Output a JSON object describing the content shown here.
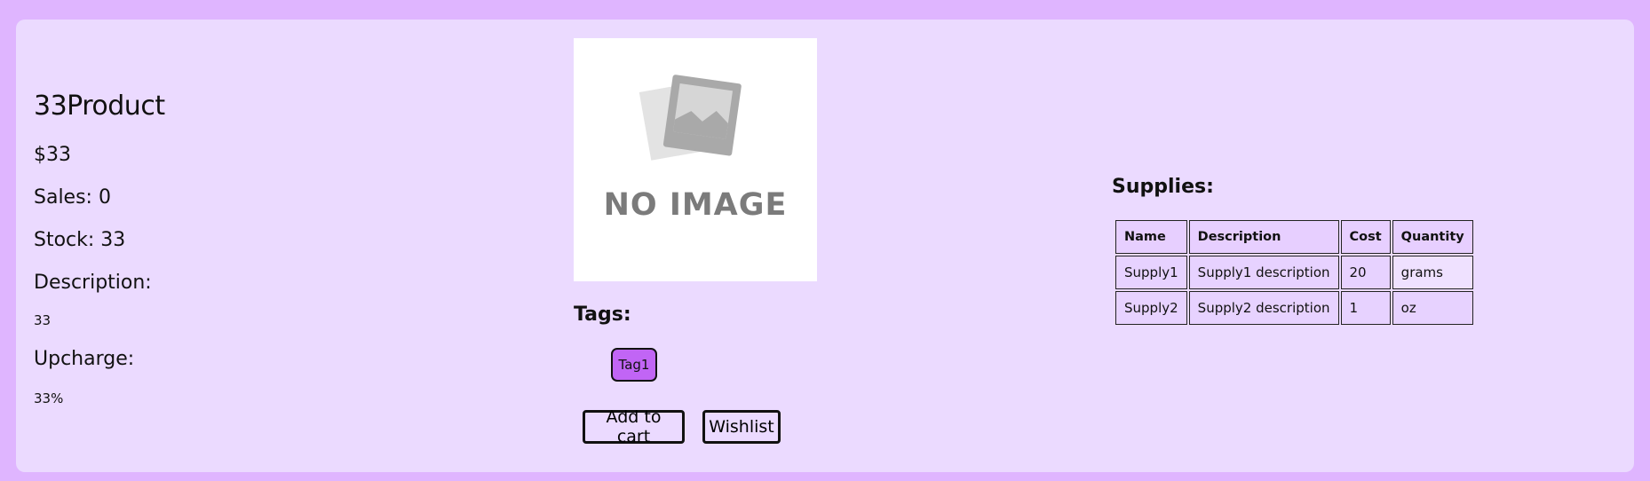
{
  "product": {
    "title": "33Product",
    "price": "$33",
    "sales": "Sales: 0",
    "stock": "Stock: 33",
    "description_label": "Description:",
    "description": "33",
    "upcharge_label": "Upcharge:",
    "upcharge": "33%"
  },
  "image": {
    "placeholder_text": "NO IMAGE",
    "icon": "image-placeholder-icon"
  },
  "tags": {
    "label": "Tags:",
    "items": [
      "Tag1"
    ]
  },
  "actions": {
    "add_to_cart": "Add to cart",
    "wishlist": "Wishlist"
  },
  "supplies": {
    "label": "Supplies:",
    "columns": [
      "Name",
      "Description",
      "Cost",
      "Quantity"
    ],
    "rows": [
      [
        "Supply1",
        "Supply1 description",
        "20",
        "grams"
      ],
      [
        "Supply2",
        "Supply2 description",
        "1",
        "oz"
      ]
    ]
  },
  "colors": {
    "page_background": "#dfb5ff",
    "card_background": "#ebdaff",
    "tag_background": "#c165f5"
  }
}
